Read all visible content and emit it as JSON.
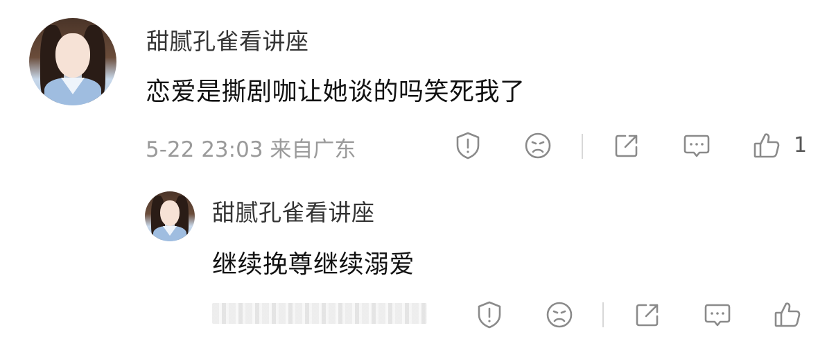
{
  "comment": {
    "user_name": "甜腻孔雀看讲座",
    "text": "恋爱是撕剧咖让她谈的吗笑死我了",
    "meta": "5-22 23:03 来自广东",
    "like_count": "1",
    "icons": [
      "report-icon",
      "dislike-face-icon",
      "share-icon",
      "reply-icon",
      "like-icon"
    ]
  },
  "reply": {
    "user_name": "甜腻孔雀看讲座",
    "text": "继续挽尊继续溺爱",
    "icons": [
      "report-icon",
      "dislike-face-icon",
      "share-icon",
      "reply-icon",
      "like-icon"
    ]
  },
  "colors": {
    "text": "#111111",
    "name": "#333333",
    "meta": "#9a9a9a",
    "icon": "#8a8a8a"
  }
}
